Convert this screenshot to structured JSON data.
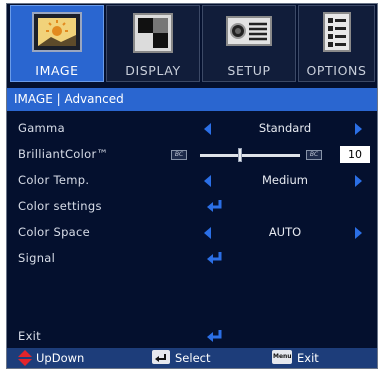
{
  "tabs": [
    {
      "label": "IMAGE",
      "icon": "image-icon",
      "active": true
    },
    {
      "label": "DISPLAY",
      "icon": "display-icon",
      "active": false
    },
    {
      "label": "SETUP",
      "icon": "projector-icon",
      "active": false
    },
    {
      "label": "OPTIONS",
      "icon": "options-icon",
      "active": false
    }
  ],
  "header": {
    "title": "IMAGE  |  Advanced"
  },
  "menu": {
    "gamma": {
      "label": "Gamma",
      "value": "Standard"
    },
    "brilliant": {
      "label": "BrilliantColor™",
      "value": "10",
      "slider_fraction": 0.4,
      "bc_tag": "BC"
    },
    "colortemp": {
      "label": "Color Temp.",
      "value": "Medium"
    },
    "colorsettings": {
      "label": "Color settings"
    },
    "colorspace": {
      "label": "Color Space",
      "value": "AUTO"
    },
    "signal": {
      "label": "Signal"
    },
    "exit": {
      "label": "Exit"
    }
  },
  "footer": {
    "updown": "UpDown",
    "select": "Select",
    "menu_key": "Menu",
    "exit": "Exit"
  },
  "colors": {
    "accent": "#2a66d0",
    "background": "#04102e",
    "arrow": "#2b6fe6"
  }
}
